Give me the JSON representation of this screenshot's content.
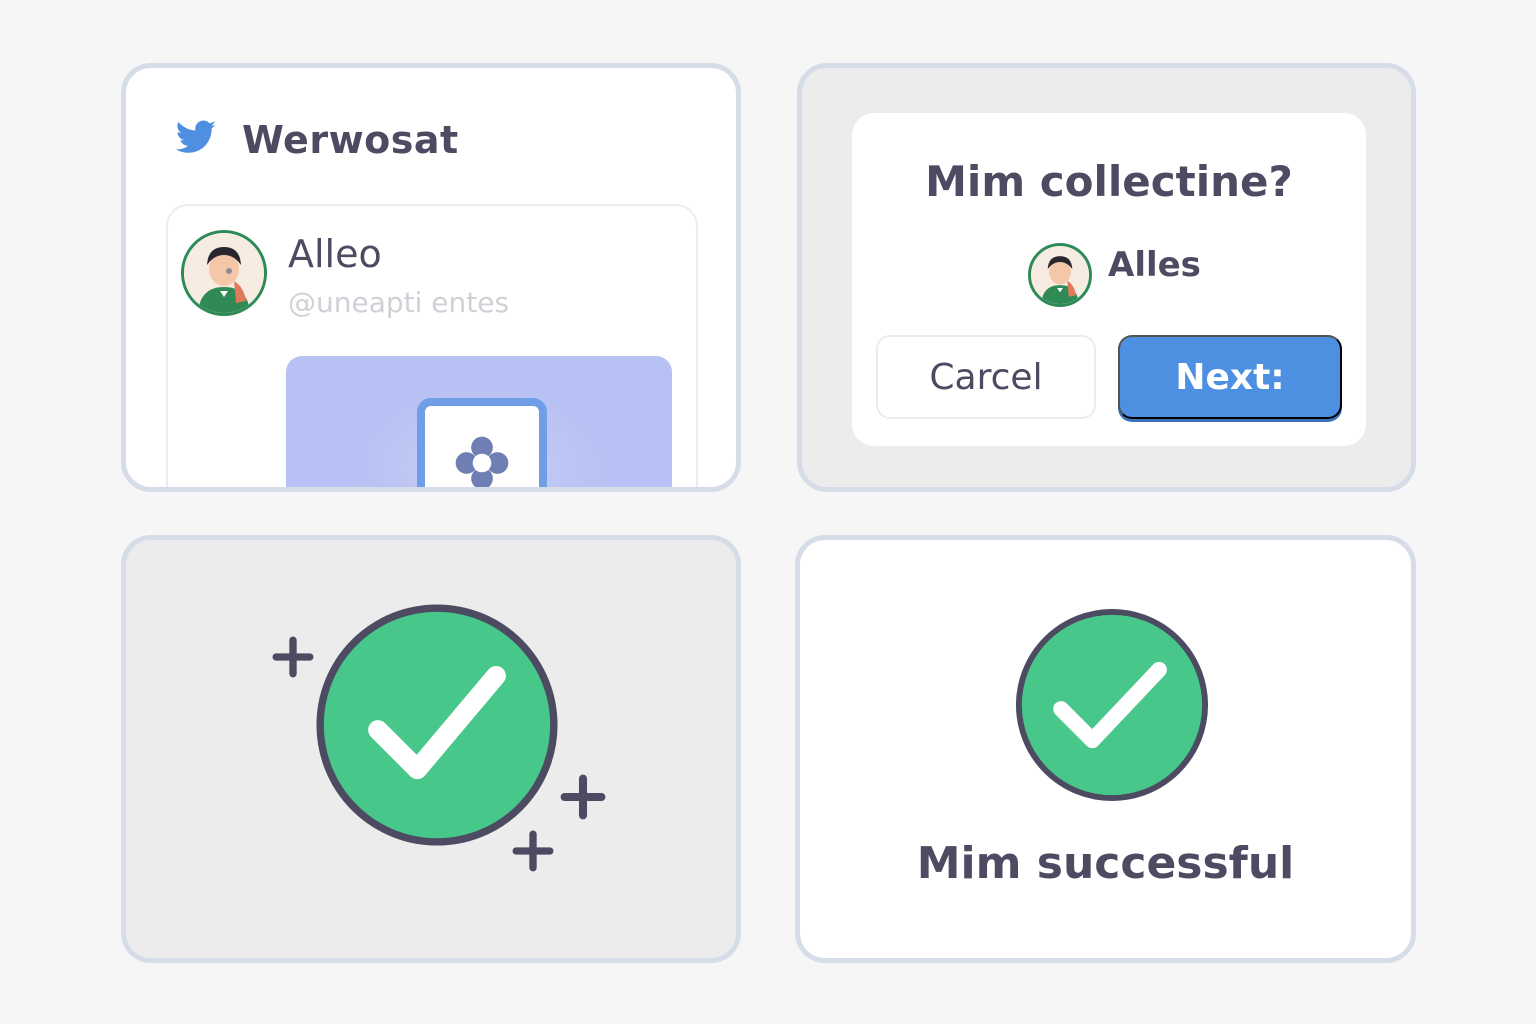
{
  "colors": {
    "background": "#f6f6f7",
    "panel_border": "#d6dce8",
    "text_dark": "#4d4b62",
    "accent_blue": "#4d8fe0",
    "success_green": "#48c78a",
    "media_bg": "#b8c1f3"
  },
  "social_panel": {
    "app_icon": "bird-icon",
    "app_title": "Werwosat",
    "post": {
      "author_name": "Alleo",
      "handle": "@uneapti entes",
      "media_icon": "flower-icon"
    }
  },
  "dialog_panel": {
    "title": "Mim collectine?",
    "user_name": "Alles",
    "cancel_label": "Carcel",
    "next_label": "Next:"
  },
  "confirm_panel": {
    "icon": "check-circle-icon",
    "sparkle_icon": "plus-icon"
  },
  "success_panel": {
    "icon": "check-circle-icon",
    "message": "Mim successful"
  }
}
